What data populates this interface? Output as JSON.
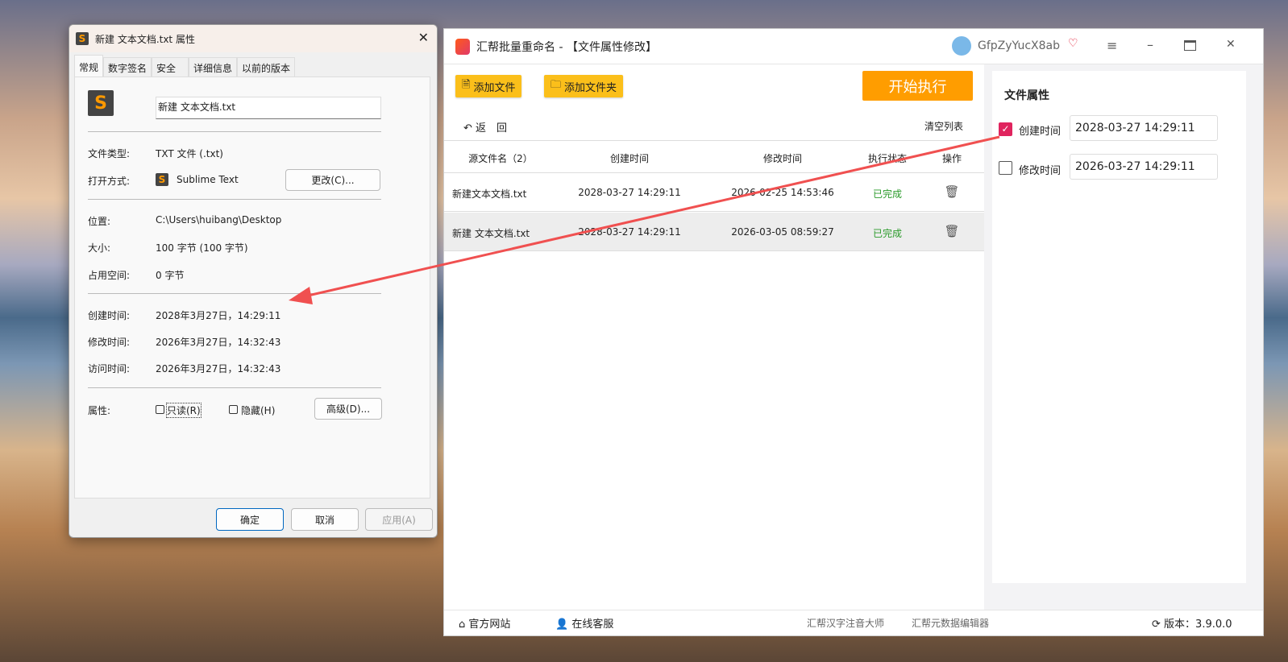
{
  "dialog": {
    "title": "新建 文本文档.txt 属性",
    "tabs": [
      "常规",
      "数字签名",
      "安全",
      "详细信息",
      "以前的版本"
    ],
    "filename": "新建 文本文档.txt",
    "labels": {
      "type": "文件类型:",
      "open": "打开方式:",
      "location": "位置:",
      "size": "大小:",
      "disk": "占用空间:",
      "created": "创建时间:",
      "modified": "修改时间:",
      "accessed": "访问时间:",
      "attrs": "属性:"
    },
    "values": {
      "type": "TXT 文件 (.txt)",
      "open": "Sublime Text",
      "location": "C:\\Users\\huibang\\Desktop",
      "size": "100 字节 (100 字节)",
      "disk": "0 字节",
      "created": "2028年3月27日，14:29:11",
      "modified": "2026年3月27日，14:32:43",
      "accessed": "2026年3月27日，14:32:43"
    },
    "change_btn": "更改(C)...",
    "readonly": "只读(R)",
    "hidden": "隐藏(H)",
    "advanced": "高级(D)...",
    "ok": "确定",
    "cancel": "取消",
    "apply": "应用(A)"
  },
  "app": {
    "title": "汇帮批量重命名 - 【文件属性修改】",
    "user": "GfpZyYucX8ab",
    "add_file": "添加文件",
    "add_folder": "添加文件夹",
    "start": "开始执行",
    "back": "返　回",
    "clear": "清空列表",
    "columns": [
      "源文件名（2）",
      "创建时间",
      "修改时间",
      "执行状态",
      "操作"
    ],
    "rows": [
      {
        "name": "新建文本文档.txt",
        "created": "2028-03-27 14:29:11",
        "modified": "2026-02-25 14:53:46",
        "status": "已完成"
      },
      {
        "name": "新建 文本文档.txt",
        "created": "2028-03-27 14:29:11",
        "modified": "2026-03-05 08:59:27",
        "status": "已完成"
      }
    ],
    "panel": {
      "title": "文件属性",
      "created_label": "创建时间",
      "created_checked": true,
      "created_value": "2028-03-27 14:29:11",
      "modified_label": "修改时间",
      "modified_checked": false,
      "modified_value": "2026-03-27 14:29:11"
    },
    "footer": {
      "site": "官方网站",
      "service": "在线客服",
      "link1": "汇帮汉字注音大师",
      "link2": "汇帮元数据编辑器",
      "version": "版本：3.9.0.0"
    },
    "colors": {
      "accent": "#fbbf1a",
      "start": "#ff9d00",
      "status": "#2a9a2a",
      "checkbox": "#e0245e",
      "arrow": "#f05050"
    }
  }
}
